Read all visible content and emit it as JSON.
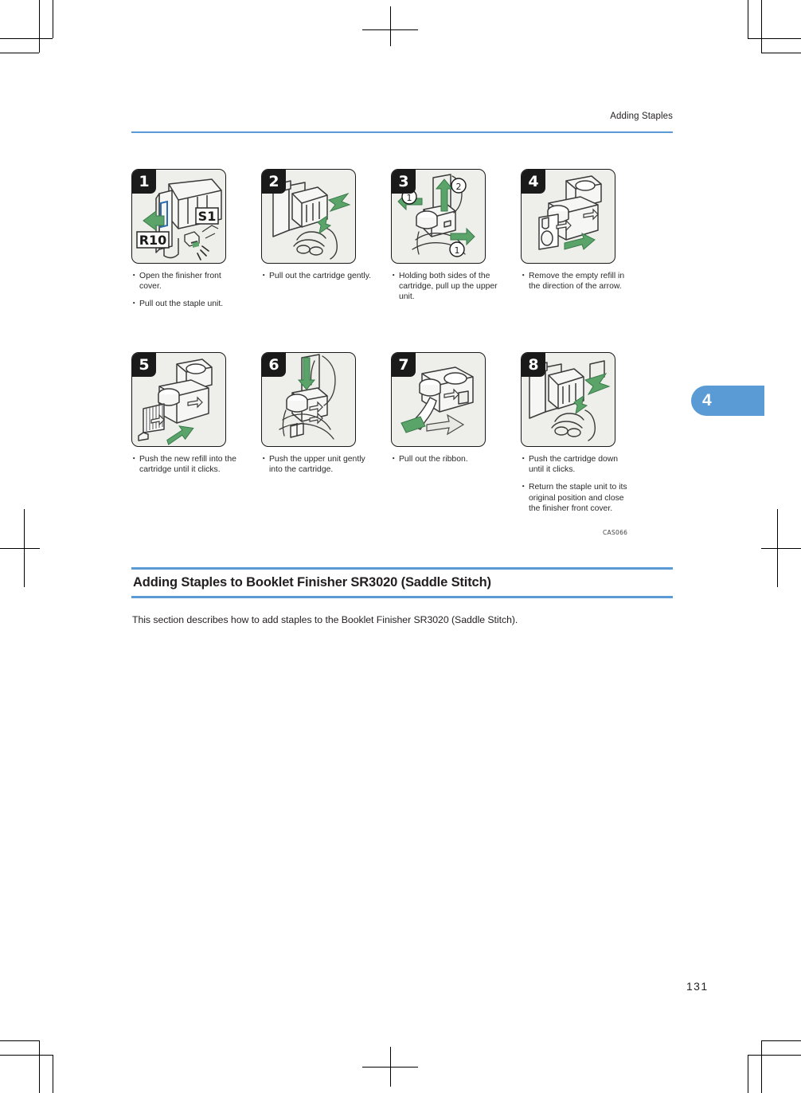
{
  "header": {
    "title": "Adding Staples",
    "rule_color": "#5b9bd5"
  },
  "chapter_tab": {
    "number": "4",
    "color": "#5b9bd5"
  },
  "figure": {
    "id": "CAS066",
    "rows": [
      {
        "cells": [
          {
            "step": "1",
            "labels": [
              "R10",
              "S1"
            ],
            "captions": [
              "Open the finisher front cover.",
              "Pull out the staple unit."
            ]
          },
          {
            "step": "2",
            "labels": [],
            "captions": [
              "Pull out the cartridge gently."
            ]
          },
          {
            "step": "3",
            "labels": [
              "1",
              "2",
              "1"
            ],
            "captions": [
              "Holding both sides of the cartridge, pull up the upper unit."
            ]
          },
          {
            "step": "4",
            "labels": [],
            "captions": [
              "Remove the empty refill in the direction of the arrow."
            ]
          }
        ]
      },
      {
        "cells": [
          {
            "step": "5",
            "labels": [],
            "captions": [
              "Push the new refill into the cartridge until it clicks."
            ]
          },
          {
            "step": "6",
            "labels": [],
            "captions": [
              "Push the upper unit gently into the cartridge."
            ]
          },
          {
            "step": "7",
            "labels": [],
            "captions": [
              "Pull out the ribbon."
            ]
          },
          {
            "step": "8",
            "labels": [],
            "captions": [
              "Push the cartridge down until it clicks.",
              "Return the staple unit to its original position and close the finisher front cover."
            ]
          }
        ]
      }
    ]
  },
  "section": {
    "heading": "Adding Staples to Booklet Finisher SR3020 (Saddle Stitch)",
    "paragraph": "This section describes how to add staples to the Booklet Finisher SR3020 (Saddle Stitch)."
  },
  "page_number": "131"
}
